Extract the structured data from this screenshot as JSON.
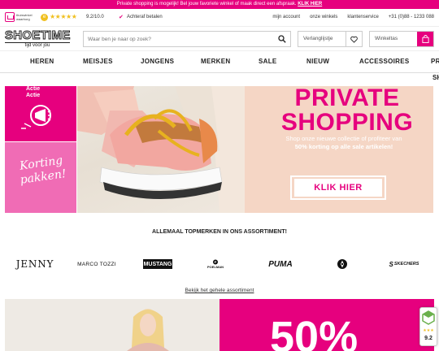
{
  "promo": {
    "text": "Private shopping is mogelijk! Bel jouw favoriete winkel of maak direct een afspraak.",
    "link": "KLIK HIER"
  },
  "trust": {
    "label": "thuiswinkel waarborg",
    "badge": "e",
    "stars": "★★★★★",
    "rating": "9.2/10.0",
    "pay_text": "Achteraf betalen",
    "links": [
      "mijn account",
      "onze winkels",
      "klantenservice",
      "+31 (0)88 - 1233 088"
    ]
  },
  "header": {
    "logo": "SHOETIME",
    "tagline": "tijd voor jou",
    "search_placeholder": "Waar ben je naar op zoek?",
    "wishlist_label": "Verlanglijstje",
    "cart_label": "Winkeltas"
  },
  "nav": {
    "items": [
      "HEREN",
      "MEISJES",
      "JONGENS",
      "MERKEN",
      "SALE",
      "NIEUW",
      "ACCESSOIRES",
      "PR"
    ],
    "overflow": "SH"
  },
  "tiles": {
    "aktie": [
      "Actie",
      "Actie"
    ],
    "korting": "Korting pakken!"
  },
  "banner": {
    "title_line1": "PRIVATE",
    "title_line2": "SHOPPING",
    "sub_line1": "Shop onze nieuwe collectie of profiteer van",
    "sub_line2": "50% korting op alle sale artikelen!",
    "cta": "KLIK HIER"
  },
  "brands": {
    "title": "ALLEMAAL TOPMERKEN IN ONS ASSORTIMENT!",
    "jenny": "JENNY",
    "marco": "MARCO TOZZI",
    "mustang": "MUSTANG",
    "poelman": "POELMAN",
    "puma": "PUMA",
    "skechers": "SKECHERS",
    "assortment_link": "Bekijk het gehele assortiment"
  },
  "bottom": {
    "percent": "50%"
  },
  "ts_widget": {
    "score": "9.2"
  },
  "colors": {
    "brand_pink": "#e6007e",
    "peach": "#f5d6c5",
    "star_gold": "#f0c020"
  }
}
